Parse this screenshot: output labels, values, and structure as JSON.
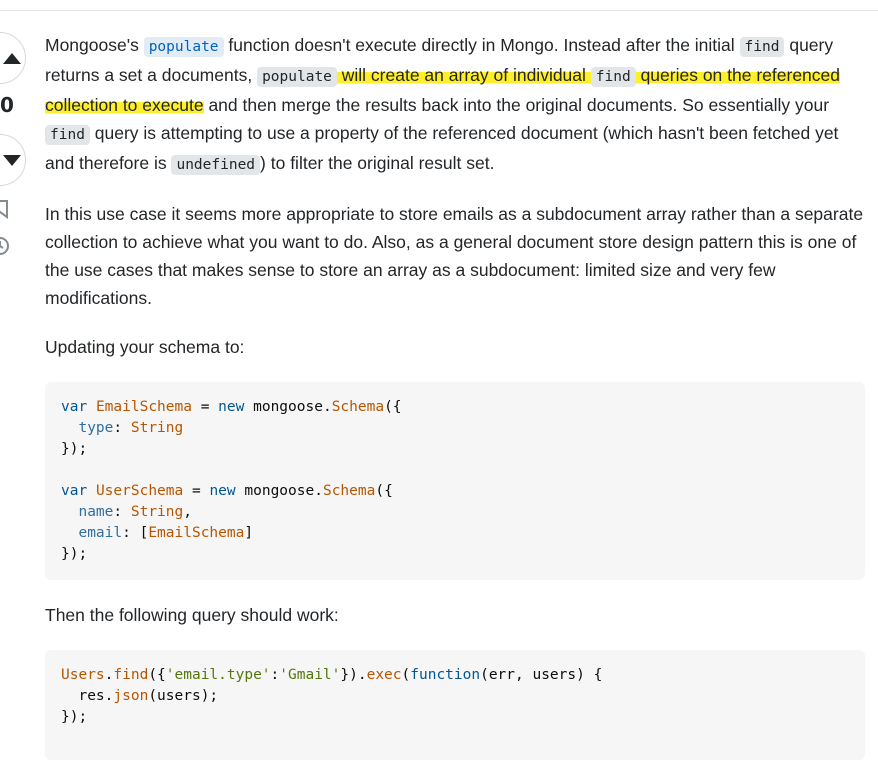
{
  "vote": {
    "count": "0"
  },
  "answer": {
    "p1": {
      "t1": "Mongoose's ",
      "link_code": "populate",
      "t2": " function doesn't execute directly in Mongo. Instead after the initial ",
      "c1": "find",
      "t3": " query returns a set a documents, ",
      "c2": "populate",
      "t4": " will create an array of individual ",
      "c3": "find",
      "t5": " queries on the referenced collection to execute",
      "t6": " and then merge the results back into the original documents. So essentially your ",
      "c4": "find",
      "t7": " query is attempting to use a property of the referenced document (which hasn't been fetched yet and therefore is ",
      "c5": "undefined",
      "t8": ") to filter the original result set."
    },
    "p2": "In this use case it seems more appropriate to store emails as a subdocument array rather than a separate collection to achieve what you want to do. Also, as a general document store design pattern this is one of the use cases that makes sense to store an array as a subdocument: limited size and very few modifications.",
    "p3": "Updating your schema to:",
    "schema_code": {
      "l1_var": "var",
      "l1_name": "EmailSchema",
      "l1_eq": " = ",
      "l1_new": "new",
      "l1_obj": " mongoose.",
      "l1_cls": "Schema",
      "l1_end": "({",
      "l2_key": "type",
      "l2_sep": ": ",
      "l2_val": "String",
      "l3": "});",
      "l5_var": "var",
      "l5_name": "UserSchema",
      "l5_eq": " = ",
      "l5_new": "new",
      "l5_obj": " mongoose.",
      "l5_cls": "Schema",
      "l5_end": "({",
      "l6_key": "name",
      "l6_sep": ": ",
      "l6_val": "String",
      "l6_end": ",",
      "l7_key": "email",
      "l7_sep": ": ",
      "l7_open": "[",
      "l7_val": "EmailSchema",
      "l7_close": "]",
      "l8": "});"
    },
    "p4": "Then the following query should work:",
    "query_code": {
      "obj": "Users",
      "dot1": ".",
      "m1": "find",
      "a1": "({",
      "s1": "'email.type'",
      "colon": ":",
      "s2": "'Gmail'",
      "a2": "}).",
      "m2": "exec",
      "a3": "(",
      "fn": "function",
      "args": "(err, users) {",
      "l2_obj": "res.",
      "l2_m": "json",
      "l2_args": "(users);",
      "l3": "});"
    }
  },
  "icons": {
    "up": "arrow-up-icon",
    "down": "arrow-down-icon",
    "bookmark": "bookmark-icon",
    "history": "history-icon"
  },
  "colors": {
    "highlight": "#ffef2a",
    "link": "#0063bf",
    "code_bg": "#f6f6f6"
  }
}
